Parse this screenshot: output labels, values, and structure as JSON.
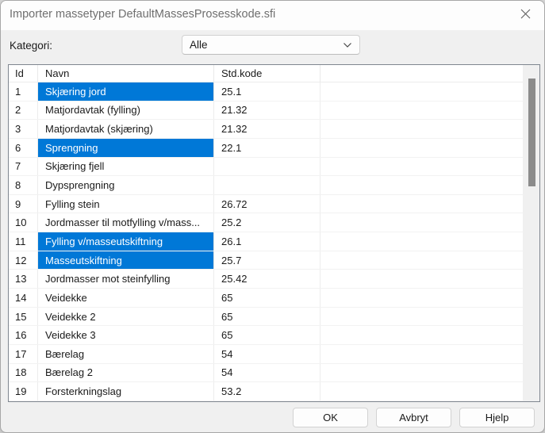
{
  "window": {
    "title": "Importer massetyper DefaultMassesProsesskode.sfi"
  },
  "filter": {
    "label": "Kategori:",
    "selected_value": "Alle"
  },
  "table": {
    "columns": [
      "Id",
      "Navn",
      "Std.kode",
      ""
    ],
    "rows": [
      {
        "id": "1",
        "name": "Skjæring jord",
        "code": "25.1",
        "selected": true
      },
      {
        "id": "2",
        "name": "Matjordavtak (fylling)",
        "code": "21.32",
        "selected": false
      },
      {
        "id": "3",
        "name": "Matjordavtak (skjæring)",
        "code": "21.32",
        "selected": false
      },
      {
        "id": "6",
        "name": "Sprengning",
        "code": "22.1",
        "selected": true
      },
      {
        "id": "7",
        "name": "Skjæring fjell",
        "code": "",
        "selected": false
      },
      {
        "id": "8",
        "name": "Dypsprengning",
        "code": "",
        "selected": false
      },
      {
        "id": "9",
        "name": "Fylling stein",
        "code": "26.72",
        "selected": false
      },
      {
        "id": "10",
        "name": "Jordmasser til motfylling v/mass...",
        "code": "25.2",
        "selected": false
      },
      {
        "id": "11",
        "name": "Fylling v/masseutskiftning",
        "code": "26.1",
        "selected": true
      },
      {
        "id": "12",
        "name": "Masseutskiftning",
        "code": "25.7",
        "selected": true
      },
      {
        "id": "13",
        "name": "Jordmasser mot steinfylling",
        "code": "25.42",
        "selected": false
      },
      {
        "id": "14",
        "name": "Veidekke",
        "code": "65",
        "selected": false
      },
      {
        "id": "15",
        "name": "Veidekke 2",
        "code": "65",
        "selected": false
      },
      {
        "id": "16",
        "name": "Veidekke 3",
        "code": "65",
        "selected": false
      },
      {
        "id": "17",
        "name": "Bærelag",
        "code": "54",
        "selected": false
      },
      {
        "id": "18",
        "name": "Bærelag 2",
        "code": "54",
        "selected": false
      },
      {
        "id": "19",
        "name": "Forsterkningslag",
        "code": "53.2",
        "selected": false
      }
    ]
  },
  "buttons": {
    "ok": "OK",
    "cancel": "Avbryt",
    "help": "Hjelp"
  },
  "icons": {
    "close": "x-cross",
    "combobox": "chevron-down"
  },
  "colors": {
    "selection_background": "#0078D7",
    "selection_text": "#ffffff",
    "titlebar_background": "#fdfdfd",
    "dialog_background": "#f0f0f0",
    "table_border": "#7f868f",
    "scroll_thumb": "#8b8b8b"
  }
}
